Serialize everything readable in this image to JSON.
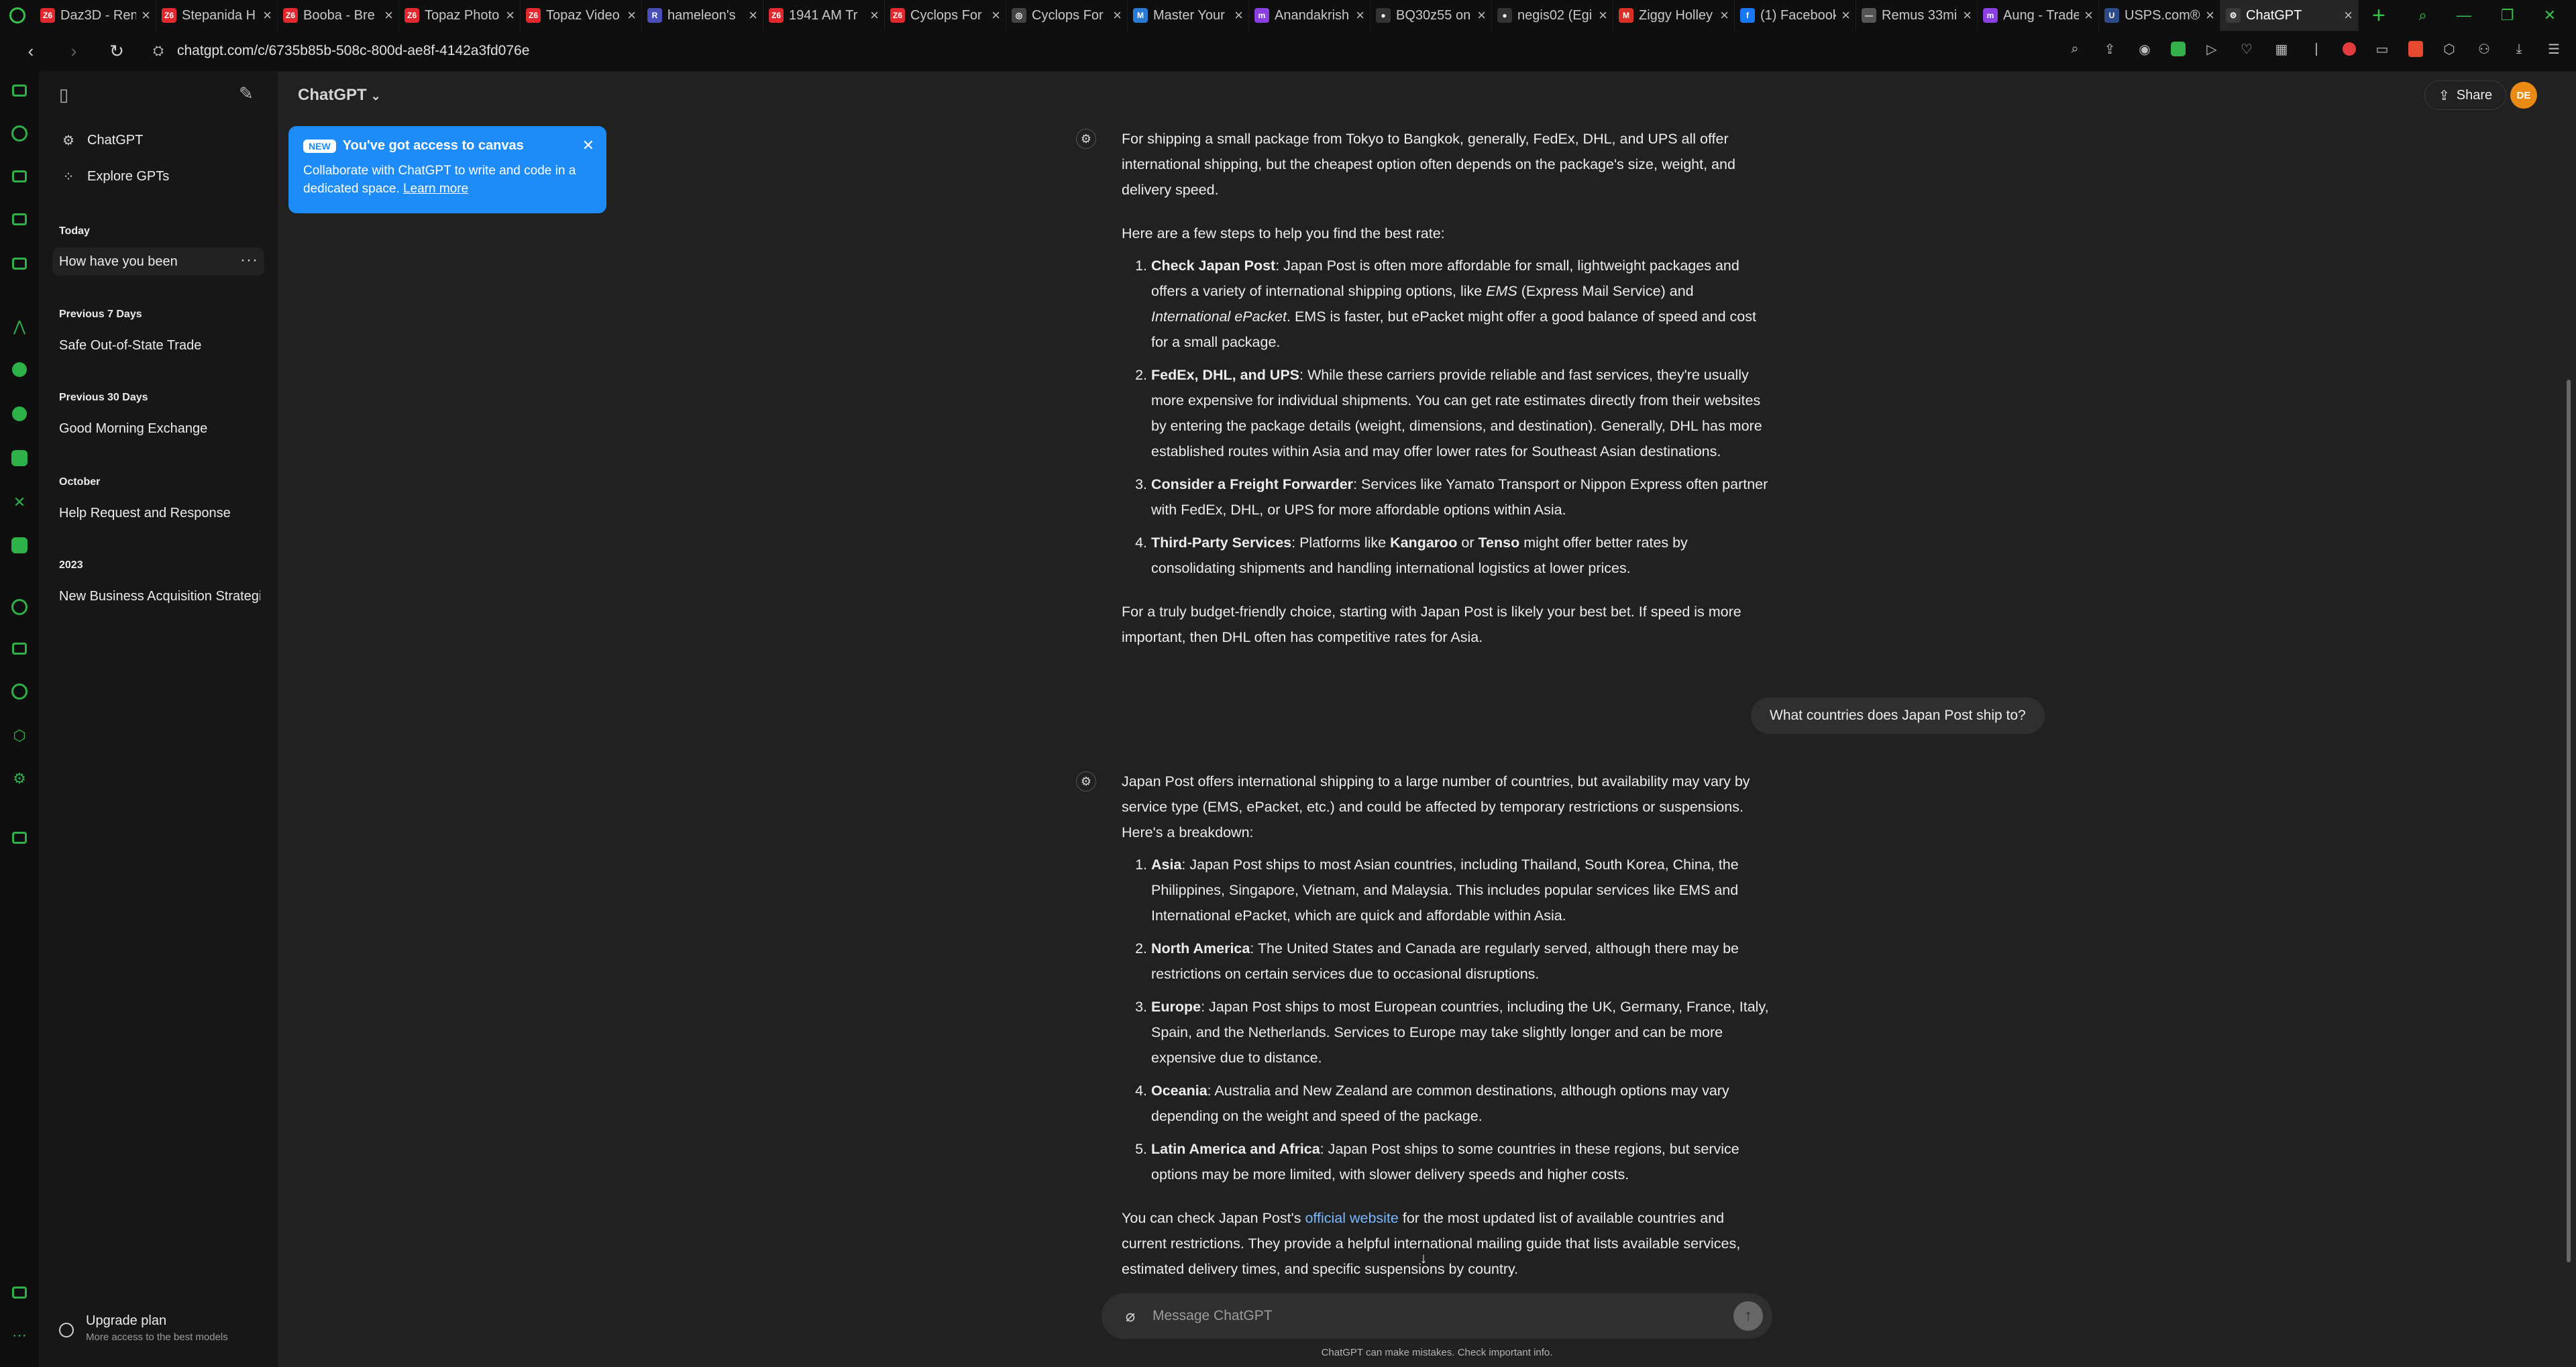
{
  "browser": {
    "tabs": [
      {
        "title": "Daz3D - Ren",
        "favicon_text": "Z6",
        "favicon_color": "#e0282e"
      },
      {
        "title": "Stepanida H",
        "favicon_text": "Z6",
        "favicon_color": "#e0282e"
      },
      {
        "title": "Booba - Bre",
        "favicon_text": "Z6",
        "favicon_color": "#e0282e"
      },
      {
        "title": "Topaz Photo",
        "favicon_text": "Z6",
        "favicon_color": "#e0282e"
      },
      {
        "title": "Topaz Video",
        "favicon_text": "Z6",
        "favicon_color": "#e0282e"
      },
      {
        "title": "hameleon's",
        "favicon_text": "R",
        "favicon_color": "#4a4fb8"
      },
      {
        "title": "1941 AM Tr",
        "favicon_text": "Z6",
        "favicon_color": "#e0282e"
      },
      {
        "title": "Cyclops For",
        "favicon_text": "Z6",
        "favicon_color": "#e0282e"
      },
      {
        "title": "Cyclops For",
        "favicon_text": "◎",
        "favicon_color": "#444444"
      },
      {
        "title": "Master Your",
        "favicon_text": "M",
        "favicon_color": "#2a7bd6"
      },
      {
        "title": "Anandakrish",
        "favicon_text": "m",
        "favicon_color": "#8a3fe0"
      },
      {
        "title": "BQ30z55 on",
        "favicon_text": "●",
        "favicon_color": "#333333"
      },
      {
        "title": "negis02 (Egi",
        "favicon_text": "●",
        "favicon_color": "#333333"
      },
      {
        "title": "Ziggy Holley",
        "favicon_text": "M",
        "favicon_color": "#d93025"
      },
      {
        "title": "(1) Facebook",
        "favicon_text": "f",
        "favicon_color": "#1877f2"
      },
      {
        "title": "Remus 33mi",
        "favicon_text": "—",
        "favicon_color": "#555555"
      },
      {
        "title": "Aung - Trade",
        "favicon_text": "m",
        "favicon_color": "#8a3fe0"
      },
      {
        "title": "USPS.com®",
        "favicon_text": "U",
        "favicon_color": "#2d4a8a"
      },
      {
        "title": "ChatGPT",
        "favicon_text": "⚙",
        "favicon_color": "#3a3a3a"
      }
    ],
    "url": "chatgpt.com/c/6735b85b-508c-800d-ae8f-4142a3fd076e",
    "accent": "#35c24d"
  },
  "sidebar": {
    "top_items": [
      {
        "label": "ChatGPT",
        "icon": "chatgpt-logo-icon"
      },
      {
        "label": "Explore GPTs",
        "icon": "grid-icon"
      }
    ],
    "sections": [
      {
        "title": "Today",
        "chats": [
          "How have you been"
        ]
      },
      {
        "title": "Previous 7 Days",
        "chats": [
          "Safe Out-of-State Trade"
        ]
      },
      {
        "title": "Previous 30 Days",
        "chats": [
          "Good Morning Exchange"
        ]
      },
      {
        "title": "October",
        "chats": [
          "Help Request and Response"
        ]
      },
      {
        "title": "2023",
        "chats": [
          "New Business Acquisition Strategies"
        ]
      }
    ],
    "more": "···",
    "upgrade": {
      "title": "Upgrade plan",
      "subtitle": "More access to the best models"
    }
  },
  "header": {
    "model": "ChatGPT",
    "share": "Share",
    "avatar_initials": "DE",
    "avatar_color": "#e98a14"
  },
  "canvas_popup": {
    "badge": "NEW",
    "title": "You've got access to canvas",
    "body": "Collaborate with ChatGPT to write and code in a dedicated space.",
    "link": "Learn more",
    "color": "#1d8cf8"
  },
  "conversation": {
    "a1": {
      "intro": "For shipping a small package from Tokyo to Bangkok, generally, FedEx, DHL, and UPS all offer international shipping, but the cheapest option often depends on the package's size, weight, and delivery speed.",
      "lead": "Here are a few steps to help you find the best rate:",
      "items": [
        {
          "bold": "Check Japan Post",
          "text_1": ": Japan Post is often more affordable for small, lightweight packages and offers a variety of international shipping options, like ",
          "em_1": "EMS",
          "text_2": " (Express Mail Service) and ",
          "em_2": "International ePacket",
          "text_3": ". EMS is faster, but ePacket might offer a good balance of speed and cost for a small package."
        },
        {
          "bold": "FedEx, DHL, and UPS",
          "text": ": While these carriers provide reliable and fast services, they're usually more expensive for individual shipments. You can get rate estimates directly from their websites by entering the package details (weight, dimensions, and destination). Generally, DHL has more established routes within Asia and may offer lower rates for Southeast Asian destinations."
        },
        {
          "bold": "Consider a Freight Forwarder",
          "text": ": Services like Yamato Transport or Nippon Express often partner with FedEx, DHL, or UPS for more affordable options within Asia."
        },
        {
          "bold": "Third-Party Services",
          "text_1": ": Platforms like ",
          "bold_2": "Kangaroo",
          "text_2": " or ",
          "bold_3": "Tenso",
          "text_3": " might offer better rates by consolidating shipments and handling international logistics at lower prices."
        }
      ],
      "outro": "For a truly budget-friendly choice, starting with Japan Post is likely your best bet. If speed is more important, then DHL often has competitive rates for Asia."
    },
    "user_message": "What countries does Japan Post ship to?",
    "a2": {
      "intro": "Japan Post offers international shipping to a large number of countries, but availability may vary by service type (EMS, ePacket, etc.) and could be affected by temporary restrictions or suspensions. Here's a breakdown:",
      "items": [
        {
          "bold": "Asia",
          "text": ": Japan Post ships to most Asian countries, including Thailand, South Korea, China, the Philippines, Singapore, Vietnam, and Malaysia. This includes popular services like EMS and International ePacket, which are quick and affordable within Asia."
        },
        {
          "bold": "North America",
          "text": ": The United States and Canada are regularly served, although there may be restrictions on certain services due to occasional disruptions."
        },
        {
          "bold": "Europe",
          "text": ": Japan Post ships to most European countries, including the UK, Germany, France, Italy, Spain, and the Netherlands. Services to Europe may take slightly longer and can be more expensive due to distance."
        },
        {
          "bold": "Oceania",
          "text": ": Australia and New Zealand are common destinations, although options may vary depending on the weight and speed of the package."
        },
        {
          "bold": "Latin America and Africa",
          "text": ": Japan Post ships to some countries in these regions, but service options may be more limited, with slower delivery speeds and higher costs."
        }
      ],
      "outro_1": "You can check Japan Post's ",
      "outro_link": "official website",
      "outro_2": " for the most updated list of available countries and current restrictions. They provide a helpful international mailing guide that lists available services, estimated delivery times, and specific suspensions by country."
    }
  },
  "composer": {
    "placeholder": "Message ChatGPT",
    "disclaimer": "ChatGPT can make mistakes. Check important info."
  }
}
